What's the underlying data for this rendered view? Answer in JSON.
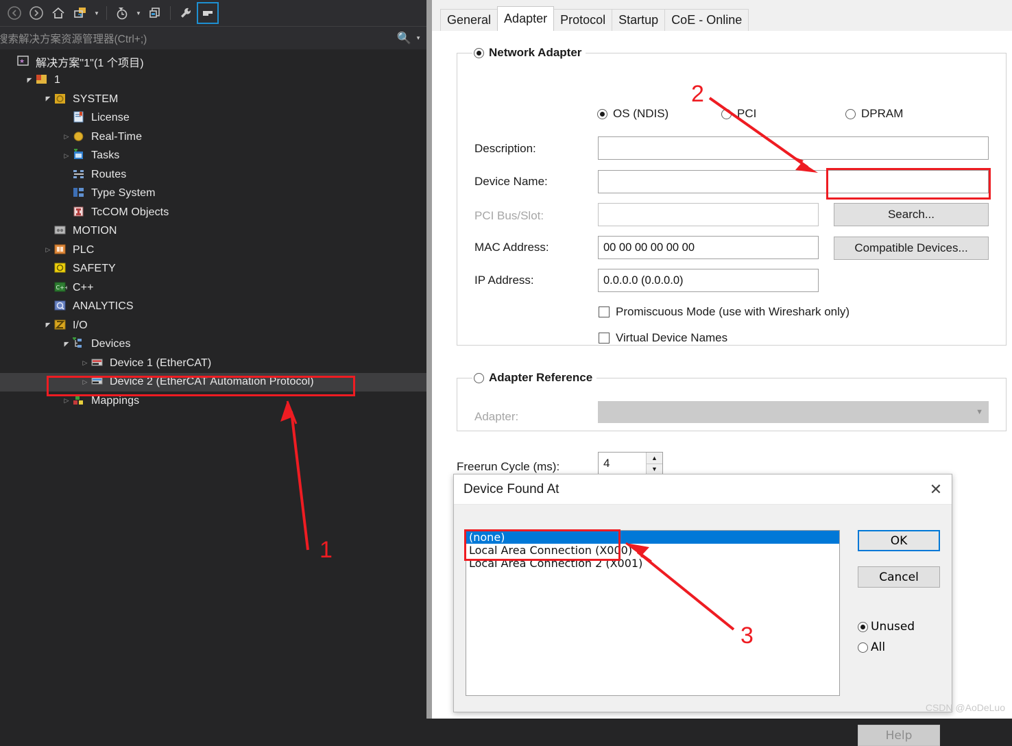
{
  "solution_explorer": {
    "toolbar": {
      "items": [
        {
          "name": "back-icon",
          "label": "Back"
        },
        {
          "name": "forward-icon",
          "label": "Forward"
        },
        {
          "name": "home-icon",
          "label": "Home"
        },
        {
          "name": "sync-with-active-document-icon",
          "label": "Sync with Active Document"
        },
        {
          "name": "pending-changes-filter-icon",
          "label": "Pending Changes Filter"
        },
        {
          "name": "refresh-icon",
          "label": "Refresh"
        },
        {
          "name": "show-all-files-icon",
          "label": "Show All Files"
        },
        {
          "name": "properties-icon",
          "label": "Properties"
        }
      ]
    },
    "search": {
      "placeholder": "搜索解决方案资源管理器(Ctrl+;)",
      "icon": "magnifier-icon",
      "dropdown_icon": "chevron-down-icon"
    },
    "tree": [
      {
        "label": "解决方案\"1\"(1 个项目)",
        "depth": 0,
        "expander": "none",
        "icon": "solution-icon",
        "selected": false
      },
      {
        "label": "1",
        "depth": 1,
        "expander": "open",
        "icon": "project-icon",
        "selected": false
      },
      {
        "label": "SYSTEM",
        "depth": 2,
        "expander": "open",
        "icon": "system-icon",
        "selected": false
      },
      {
        "label": "License",
        "depth": 3,
        "expander": "none",
        "icon": "license-icon",
        "selected": false
      },
      {
        "label": "Real-Time",
        "depth": 3,
        "expander": "closed",
        "icon": "realtime-icon",
        "selected": false
      },
      {
        "label": "Tasks",
        "depth": 3,
        "expander": "closed",
        "icon": "tasks-icon",
        "selected": false
      },
      {
        "label": "Routes",
        "depth": 3,
        "expander": "none",
        "icon": "routes-icon",
        "selected": false
      },
      {
        "label": "Type System",
        "depth": 3,
        "expander": "none",
        "icon": "type-system-icon",
        "selected": false
      },
      {
        "label": "TcCOM Objects",
        "depth": 3,
        "expander": "none",
        "icon": "tccom-icon",
        "selected": false
      },
      {
        "label": "MOTION",
        "depth": 2,
        "expander": "none",
        "icon": "motion-icon",
        "selected": false
      },
      {
        "label": "PLC",
        "depth": 2,
        "expander": "closed",
        "icon": "plc-icon",
        "selected": false
      },
      {
        "label": "SAFETY",
        "depth": 2,
        "expander": "none",
        "icon": "safety-icon",
        "selected": false
      },
      {
        "label": "C++",
        "depth": 2,
        "expander": "none",
        "icon": "cpp-icon",
        "selected": false
      },
      {
        "label": "ANALYTICS",
        "depth": 2,
        "expander": "none",
        "icon": "analytics-icon",
        "selected": false
      },
      {
        "label": "I/O",
        "depth": 2,
        "expander": "open",
        "icon": "io-icon",
        "selected": false
      },
      {
        "label": "Devices",
        "depth": 3,
        "expander": "open",
        "icon": "devices-icon",
        "selected": false
      },
      {
        "label": "Device 1 (EtherCAT)",
        "depth": 4,
        "expander": "closed",
        "icon": "device-red-icon",
        "selected": false
      },
      {
        "label": "Device 2 (EtherCAT Automation Protocol)",
        "depth": 4,
        "expander": "closed",
        "icon": "device-blue-icon",
        "selected": true
      },
      {
        "label": "Mappings",
        "depth": 3,
        "expander": "closed",
        "icon": "mappings-icon",
        "selected": false
      }
    ]
  },
  "properties": {
    "tabs": [
      {
        "label": "General",
        "active": false
      },
      {
        "label": "Adapter",
        "active": true
      },
      {
        "label": "Protocol",
        "active": false
      },
      {
        "label": "Startup",
        "active": false
      },
      {
        "label": "CoE - Online",
        "active": false
      }
    ],
    "network_adapter": {
      "group_label": "Network Adapter",
      "group_selected": true,
      "mode_options": [
        {
          "label": "OS (NDIS)",
          "selected": true
        },
        {
          "label": "PCI",
          "selected": false
        },
        {
          "label": "DPRAM",
          "selected": false
        }
      ],
      "fields": [
        {
          "label": "Description:",
          "value": "",
          "disabled": false
        },
        {
          "label": "Device Name:",
          "value": "",
          "disabled": false
        },
        {
          "label": "PCI Bus/Slot:",
          "value": "",
          "disabled": true
        },
        {
          "label": "MAC Address:",
          "value": "00 00 00 00 00 00",
          "disabled": false
        },
        {
          "label": "IP Address:",
          "value": "0.0.0.0 (0.0.0.0)",
          "disabled": false
        }
      ],
      "buttons": [
        {
          "label": "Search...",
          "highlighted": true
        },
        {
          "label": "Compatible Devices...",
          "highlighted": false
        }
      ],
      "checkboxes": [
        {
          "label": "Promiscuous Mode (use with Wireshark only)",
          "checked": false
        },
        {
          "label": "Virtual Device Names",
          "checked": false
        }
      ]
    },
    "adapter_reference": {
      "group_label": "Adapter Reference",
      "group_selected": false,
      "adapter_label": "Adapter:",
      "adapter_value": "",
      "dropdown_icon": "chevron-down-icon"
    },
    "freerun": {
      "label": "Freerun Cycle (ms):",
      "value": "4",
      "spinner_up_icon": "triangle-up-icon",
      "spinner_down_icon": "triangle-down-icon"
    }
  },
  "dialog": {
    "title": "Device Found At",
    "close_icon": "close-icon",
    "list_items": [
      {
        "label": "(none)",
        "selected": true
      },
      {
        "label": "Local Area Connection (X000)",
        "selected": false
      },
      {
        "label": "Local Area Connection 2 (X001)",
        "selected": false
      }
    ],
    "buttons": [
      {
        "label": "OK",
        "default": true,
        "disabled": false
      },
      {
        "label": "Cancel",
        "default": false,
        "disabled": false
      },
      {
        "label": "Help",
        "default": false,
        "disabled": true
      }
    ],
    "filter_options": [
      {
        "label": "Unused",
        "selected": true
      },
      {
        "label": "All",
        "selected": false
      }
    ]
  },
  "annotations": {
    "accent_color": "#ee1c22",
    "markers": [
      {
        "id": "1",
        "target": "Device 2 (EtherCAT Automation Protocol) tree node"
      },
      {
        "id": "2",
        "target": "Search... button"
      },
      {
        "id": "3",
        "target": "Local Area Connection list entries"
      }
    ]
  },
  "watermark": "CSDN @AoDeLuo"
}
